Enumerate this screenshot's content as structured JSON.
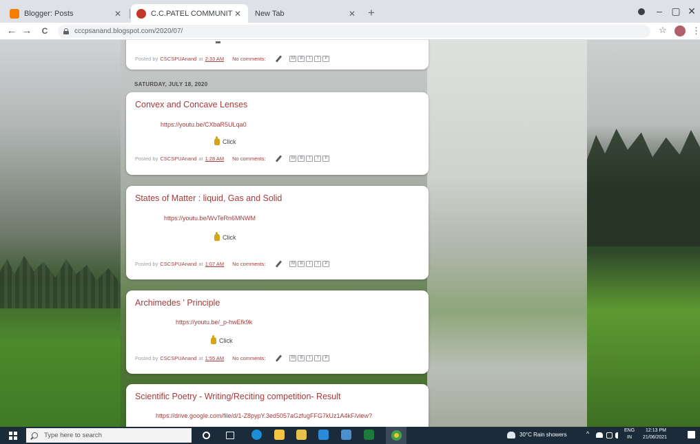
{
  "browser": {
    "tabs": [
      {
        "title": "Blogger: Posts",
        "favicon_color": "#f57d00",
        "active": false
      },
      {
        "title": "C.C.PATEL COMMUNITY SCIENC",
        "favicon_color": "#c0392b",
        "active": true
      },
      {
        "title": "New Tab",
        "favicon_color": "",
        "active": false
      }
    ],
    "new_tab_label": "+",
    "window_controls": {
      "minimize": "–",
      "maximize": "▢",
      "close": "✕"
    },
    "nav": {
      "back": "←",
      "forward": "→",
      "reload": "C"
    },
    "address": "cccpsanand.blogspot.com/2020/07/",
    "star": "☆",
    "menu": "⋮"
  },
  "blog": {
    "top_post_footer": {
      "posted_by": "Posted by",
      "author": "CSCSPUAnand",
      "at": "at",
      "time": "2:33 AM",
      "comments": "No comments:"
    },
    "date_header": "SATURDAY, JULY 18, 2020",
    "posts": [
      {
        "title": "Convex and Concave Lenses",
        "link": "https://youtu.be/CXbaR5ULqa0",
        "click_label": "Click",
        "posted_by": "Posted by",
        "author": "CSCSPUAnand",
        "at": "at",
        "time": "1:28 AM",
        "comments": "No comments:"
      },
      {
        "title": "States of Matter : liquid, Gas and Solid",
        "link": "https://youtu.be/WvTeRn6MNWM",
        "click_label": "Click",
        "posted_by": "Posted by",
        "author": "CSCSPUAnand",
        "at": "at",
        "time": "1:07 AM",
        "comments": "No comments:"
      },
      {
        "title": "Archimedes ' Principle",
        "link": "https://youtu.be/_p-hwEfk9k",
        "click_label": "Click",
        "posted_by": "Posted by",
        "author": "CSCSPUAnand",
        "at": "at",
        "time": "1:55 AM",
        "comments": "No comments:"
      },
      {
        "title": "Scientific Poetry - Writing/Reciting competition- Result",
        "link": "https://drive.google.com/file/d/1-Z8pypY.3ed5057aGzfugFFG7kUz1A4kF/view?"
      }
    ],
    "share_buttons": [
      "M",
      "B",
      "t",
      "f",
      "P"
    ]
  },
  "taskbar": {
    "search_placeholder": "Type here to search",
    "weather": "30°C  Rain showers",
    "lang_top": "ENG",
    "lang_bottom": "IN",
    "time": "12:13 PM",
    "date": "21/06/2021",
    "tray_arrow": "^"
  }
}
